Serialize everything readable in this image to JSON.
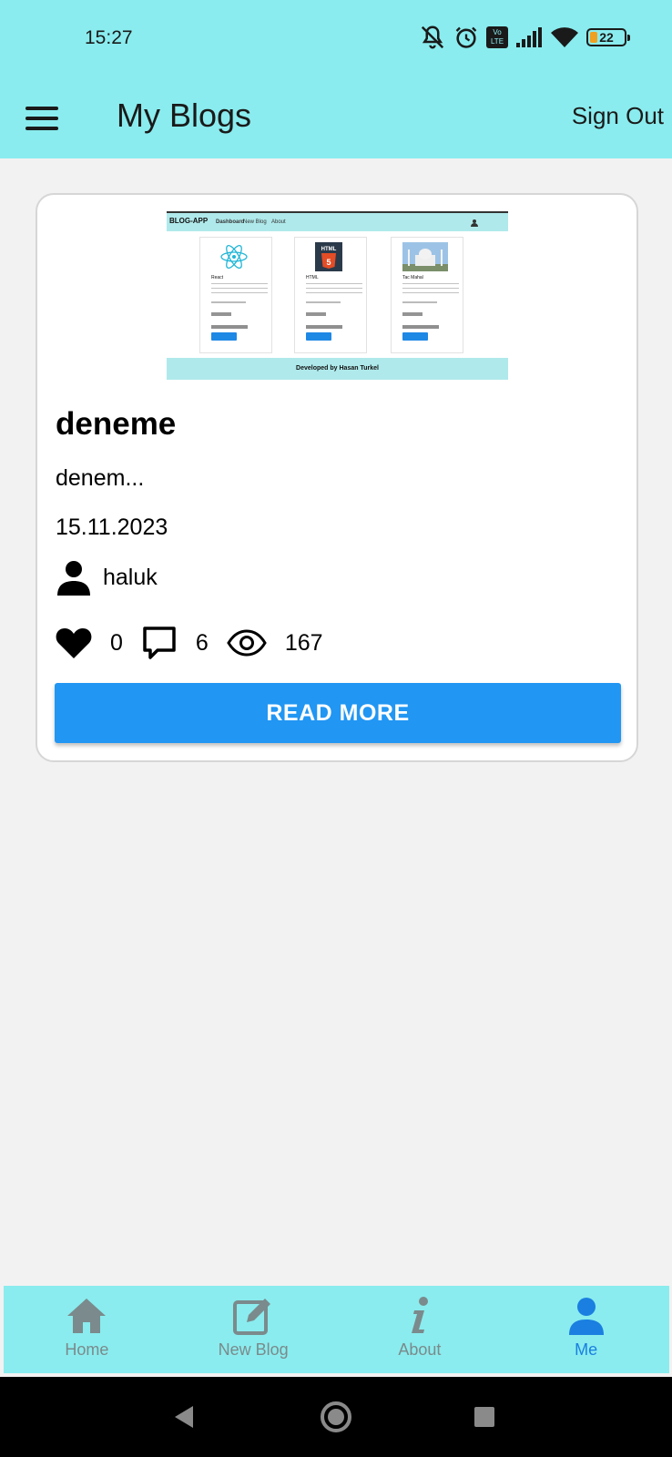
{
  "status_bar": {
    "time": "15:27",
    "battery": "22",
    "network_badge": "Vo LTE",
    "icons": [
      "mute-bell-icon",
      "alarm-icon",
      "volte-icon",
      "signal-icon",
      "wifi-icon",
      "battery-icon"
    ]
  },
  "app_bar": {
    "title": "My Blogs",
    "sign_out_label": "Sign Out",
    "menu_icon": "hamburger-menu-icon"
  },
  "blog": {
    "thumbnail": {
      "brand": "BLOG-APP",
      "nav_links": [
        "Dashboard",
        "New Blog",
        "About"
      ],
      "cards": [
        "React",
        "HTML",
        "Tac Mahal"
      ],
      "footer": "Developed by Hasan Turkel"
    },
    "title": "deneme",
    "excerpt": "denem...",
    "date": "15.11.2023",
    "author": "haluk",
    "likes": "0",
    "comments": "6",
    "views": "167",
    "read_more_label": "READ MORE"
  },
  "bottom_nav": {
    "items": [
      {
        "label": "Home",
        "icon": "home-icon",
        "active": false
      },
      {
        "label": "New Blog",
        "icon": "edit-icon",
        "active": false
      },
      {
        "label": "About",
        "icon": "info-icon",
        "active": false
      },
      {
        "label": "Me",
        "icon": "person-icon",
        "active": true
      }
    ]
  },
  "colors": {
    "app_bar": "#8aecee",
    "primary_button": "#2196f3",
    "active_nav": "#1a7fe0",
    "inactive_nav": "#7b8a8c"
  }
}
